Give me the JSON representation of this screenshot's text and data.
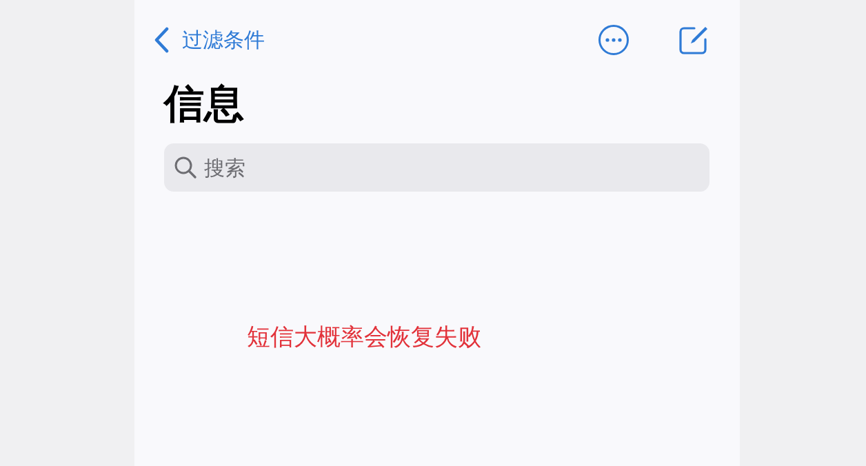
{
  "nav": {
    "back_label": "过滤条件"
  },
  "title": "信息",
  "search": {
    "placeholder": "搜索"
  },
  "annotation": "短信大概率会恢复失败"
}
